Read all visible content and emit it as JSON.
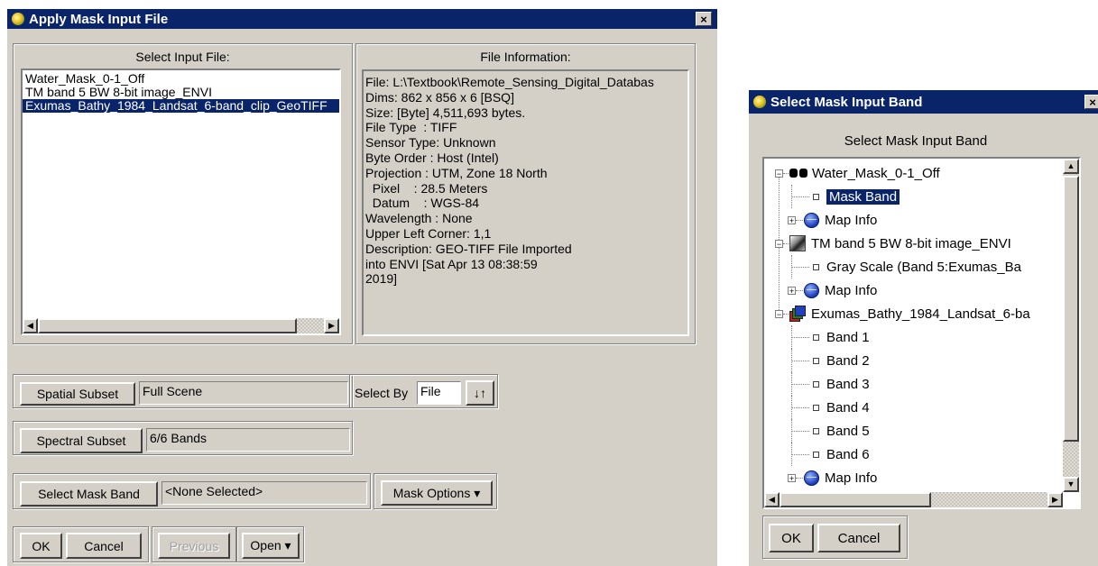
{
  "apply_dialog": {
    "title": "Apply Mask Input File",
    "close_label": "×",
    "select_input_label": "Select Input File:",
    "files": [
      {
        "label": "Water_Mask_0-1_Off",
        "selected": false
      },
      {
        "label": "TM band 5 BW 8-bit image_ENVI",
        "selected": false
      },
      {
        "label": "Exumas_Bathy_1984_Landsat_6-band_clip_GeoTIFF",
        "selected": true
      }
    ],
    "file_info_label": "File Information:",
    "file_info": [
      "File: L:\\Textbook\\Remote_Sensing_Digital_Databas",
      "Dims: 862 x 856 x 6 [BSQ]",
      "Size: [Byte] 4,511,693 bytes.",
      "File Type  : TIFF",
      "Sensor Type: Unknown",
      "Byte Order : Host (Intel)",
      "Projection : UTM, Zone 18 North",
      "  Pixel    : 28.5 Meters",
      "  Datum    : WGS-84",
      "Wavelength : None",
      "Upper Left Corner: 1,1",
      "Description: GEO-TIFF File Imported",
      "into ENVI [Sat Apr 13 08:38:59",
      "2019]"
    ],
    "spatial_subset_button": "Spatial Subset",
    "spatial_subset_value": "Full Scene",
    "select_by_label": "Select By",
    "select_by_value": "File",
    "sort_icon_glyph": "↓↑",
    "spectral_subset_button": "Spectral Subset",
    "spectral_subset_value": "6/6 Bands",
    "select_mask_band_button": "Select Mask Band",
    "mask_band_value": "<None Selected>",
    "mask_options_button": "Mask Options ▾",
    "ok_button": "OK",
    "cancel_button": "Cancel",
    "previous_button": "Previous",
    "open_button": "Open ▾"
  },
  "band_dialog": {
    "title": "Select Mask Input Band",
    "close_label": "×",
    "heading": "Select Mask Input Band",
    "tree": [
      {
        "kind": "file",
        "icon": "mask-glasses-icon",
        "label": "Water_Mask_0-1_Off"
      },
      {
        "kind": "band",
        "label": "Mask Band",
        "selected": true
      },
      {
        "kind": "mapinfo",
        "icon": "globe-icon",
        "label": "Map Info"
      },
      {
        "kind": "file",
        "icon": "grayscale-image-icon",
        "label": "TM band 5 BW 8-bit image_ENVI"
      },
      {
        "kind": "band",
        "label": "Gray Scale (Band 5:Exumas_Ba",
        "selected": false
      },
      {
        "kind": "mapinfo",
        "icon": "globe-icon",
        "label": "Map Info"
      },
      {
        "kind": "file",
        "icon": "multiband-image-icon",
        "label": "Exumas_Bathy_1984_Landsat_6-ba"
      },
      {
        "kind": "band",
        "label": "Band 1",
        "selected": false
      },
      {
        "kind": "band",
        "label": "Band 2",
        "selected": false
      },
      {
        "kind": "band",
        "label": "Band 3",
        "selected": false
      },
      {
        "kind": "band",
        "label": "Band 4",
        "selected": false
      },
      {
        "kind": "band",
        "label": "Band 5",
        "selected": false
      },
      {
        "kind": "band",
        "label": "Band 6",
        "selected": false
      },
      {
        "kind": "mapinfo",
        "icon": "globe-icon",
        "label": "Map Info"
      }
    ],
    "ok_button": "OK",
    "cancel_button": "Cancel"
  },
  "colors": {
    "title_bar": "#0a246a",
    "dialog_face": "#d4d0c8",
    "selection": "#0a246a"
  }
}
